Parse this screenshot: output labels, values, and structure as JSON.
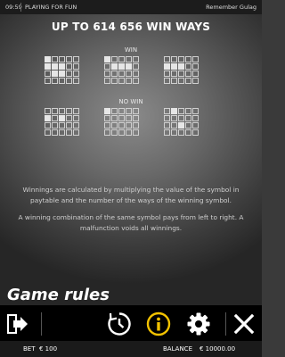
{
  "topbar": {
    "time": "09:59",
    "mode": "PLAYING FOR FUN",
    "game_name": "Remember Gulag"
  },
  "title": "UP TO 614 656 WIN WAYS",
  "win_label": "WIN",
  "nowin_label": "NO WIN",
  "win_examples": [
    {
      "cells": [
        [
          1,
          0,
          0,
          0,
          0
        ],
        [
          1,
          1,
          1,
          0,
          0
        ],
        [
          0,
          1,
          1,
          0,
          0
        ],
        [
          0,
          0,
          0,
          0,
          0
        ]
      ]
    },
    {
      "cells": [
        [
          1,
          0,
          0,
          0,
          0
        ],
        [
          0,
          1,
          1,
          1,
          0
        ],
        [
          0,
          0,
          0,
          0,
          0
        ],
        [
          0,
          0,
          0,
          0,
          0
        ]
      ]
    },
    {
      "cells": [
        [
          0,
          0,
          0,
          0,
          0
        ],
        [
          1,
          1,
          1,
          0,
          0
        ],
        [
          0,
          0,
          0,
          0,
          0
        ],
        [
          0,
          0,
          0,
          0,
          0
        ]
      ]
    }
  ],
  "nowin_examples": [
    {
      "cells": [
        [
          0,
          0,
          0,
          0,
          0
        ],
        [
          1,
          0,
          1,
          0,
          0
        ],
        [
          0,
          0,
          0,
          0,
          0
        ],
        [
          0,
          0,
          0,
          0,
          0
        ]
      ]
    },
    {
      "cells": [
        [
          1,
          0,
          0,
          0,
          0
        ],
        [
          0,
          0,
          0,
          0,
          0
        ],
        [
          0,
          0,
          0,
          0,
          0
        ],
        [
          0,
          0,
          0,
          0,
          0
        ]
      ]
    },
    {
      "cells": [
        [
          0,
          1,
          0,
          0,
          0
        ],
        [
          0,
          0,
          0,
          0,
          0
        ],
        [
          0,
          0,
          1,
          0,
          0
        ],
        [
          0,
          0,
          0,
          0,
          0
        ]
      ]
    }
  ],
  "rules": {
    "p1": "Winnings are calculated by multiplying the value of the symbol in paytable and the number of the ways of the winning symbol.",
    "p2": "A winning combination of the same symbol pays from left to right. A malfunction voids all winnings."
  },
  "heading": "Game rules",
  "toolbar": {
    "icons": [
      "exit-icon",
      "history-icon",
      "info-icon",
      "settings-icon",
      "close-icon"
    ],
    "info_color": "#f2c200"
  },
  "status": {
    "bet_label": "BET",
    "bet_value": "€ 100",
    "balance_label": "BALANCE",
    "balance_value": "€ 10000.00"
  }
}
